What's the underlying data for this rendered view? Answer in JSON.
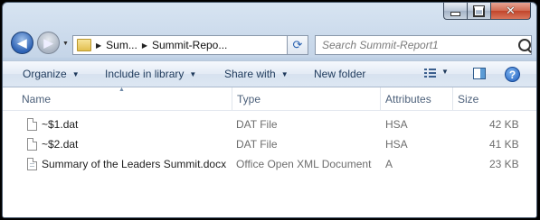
{
  "window": {
    "caption": {
      "minimize": "minimize",
      "maximize": "maximize",
      "close": "✕"
    }
  },
  "nav": {
    "back_label": "◀",
    "forward_label": "▶",
    "breadcrumbs": [
      "Sum...",
      "Summit-Repo..."
    ],
    "search_placeholder": "Search Summit-Report1"
  },
  "toolbar": {
    "organize": "Organize",
    "include_in_library": "Include in library",
    "share_with": "Share with",
    "new_folder": "New folder"
  },
  "columns": {
    "name": "Name",
    "type": "Type",
    "attributes": "Attributes",
    "size": "Size"
  },
  "files": [
    {
      "name": "~$1.dat",
      "type": "DAT File",
      "attributes": "HSA",
      "size": "42 KB",
      "icon": "blank-file-icon"
    },
    {
      "name": "~$2.dat",
      "type": "DAT File",
      "attributes": "HSA",
      "size": "41 KB",
      "icon": "blank-file-icon"
    },
    {
      "name": "Summary of the Leaders Summit.docx",
      "type": "Office Open XML Document",
      "attributes": "A",
      "size": "23 KB",
      "icon": "document-icon"
    }
  ],
  "colors": {
    "accent": "#1e395b",
    "header_text": "#4c607a",
    "meta_text": "#6d6d6d"
  }
}
